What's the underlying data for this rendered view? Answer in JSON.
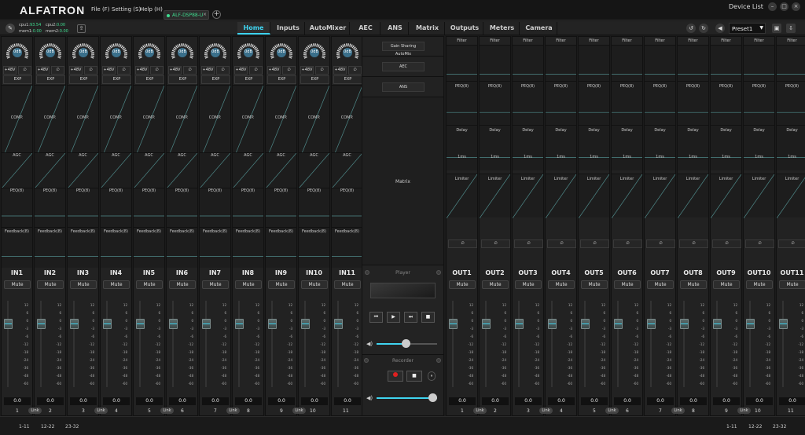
{
  "app": {
    "logo": "ALFATRON",
    "device_list": "Device List"
  },
  "menu": {
    "file": "File (F)",
    "setting": "Setting (S)",
    "help": "Help (H)"
  },
  "device_tab": {
    "label": "ALF-DSP88-U",
    "close": "×"
  },
  "status": {
    "cpu1_label": "cpu1:",
    "cpu1": "93.54",
    "mem1_label": "mem1:",
    "mem1": "0.00",
    "cpu2_label": "cpu2:",
    "cpu2": "0.00",
    "mem2_label": "mem2:",
    "mem2": "0.00"
  },
  "tabs": [
    "Home",
    "Inputs",
    "AutoMixer",
    "AEC",
    "ANS",
    "Matrix",
    "Outputs",
    "Meters",
    "Camera"
  ],
  "active_tab": "Home",
  "preset": {
    "value": "Preset1"
  },
  "input_strip": {
    "gain": "0dB",
    "phantom": "+48V",
    "phase": "∅",
    "exp": "EXP",
    "comp": "COMP.",
    "agc": "AGC",
    "peq": "PEQ(8)",
    "feedback": "Feedback(8)",
    "mute": "Mute"
  },
  "output_strip": {
    "filter": "Filter",
    "peq": "PEQ(8)",
    "delay": "Delay",
    "delay_value": "1ms",
    "limiter": "Limiter",
    "phase": "∅",
    "mute": "Mute"
  },
  "inputs": [
    {
      "name": "IN1",
      "num": "1",
      "value": "0.0"
    },
    {
      "name": "IN2",
      "num": "2",
      "value": "0.0"
    },
    {
      "name": "IN3",
      "num": "3",
      "value": "0.0"
    },
    {
      "name": "IN4",
      "num": "4",
      "value": "0.0"
    },
    {
      "name": "IN5",
      "num": "5",
      "value": "0.0"
    },
    {
      "name": "IN6",
      "num": "6",
      "value": "0.0"
    },
    {
      "name": "IN7",
      "num": "7",
      "value": "0.0"
    },
    {
      "name": "IN8",
      "num": "8",
      "value": "0.0"
    },
    {
      "name": "IN9",
      "num": "9",
      "value": "0.0"
    },
    {
      "name": "IN10",
      "num": "10",
      "value": "0.0"
    },
    {
      "name": "IN11",
      "num": "11",
      "value": "0.0"
    }
  ],
  "outputs": [
    {
      "name": "OUT1",
      "num": "1",
      "value": "0.0"
    },
    {
      "name": "OUT2",
      "num": "2",
      "value": "0.0"
    },
    {
      "name": "OUT3",
      "num": "3",
      "value": "0.0"
    },
    {
      "name": "OUT4",
      "num": "4",
      "value": "0.0"
    },
    {
      "name": "OUT5",
      "num": "5",
      "value": "0.0"
    },
    {
      "name": "OUT6",
      "num": "6",
      "value": "0.0"
    },
    {
      "name": "OUT7",
      "num": "7",
      "value": "0.0"
    },
    {
      "name": "OUT8",
      "num": "8",
      "value": "0.0"
    },
    {
      "name": "OUT9",
      "num": "9",
      "value": "0.0"
    },
    {
      "name": "OUT10",
      "num": "10",
      "value": "0.0"
    },
    {
      "name": "OUT11",
      "num": "11",
      "value": "0.0"
    }
  ],
  "link_label": "Link",
  "fader_ticks": [
    "12",
    "6",
    "0",
    "-3",
    "-6",
    "-12",
    "-18",
    "-24",
    "-36",
    "-48",
    "-60"
  ],
  "middle": {
    "automix": "Gain Sharing AutoMix",
    "aec": "AEC",
    "ans": "ANS",
    "matrix": "Matrix",
    "player": "Player",
    "recorder": "Recorder"
  },
  "pages_left": [
    "1-11",
    "12-22",
    "23-32"
  ],
  "pages_right": [
    "1-11",
    "12-22",
    "23-32"
  ],
  "colors": {
    "accent": "#3fd4f0",
    "status_green": "#3fdc8f",
    "record_red": "#e02020"
  }
}
